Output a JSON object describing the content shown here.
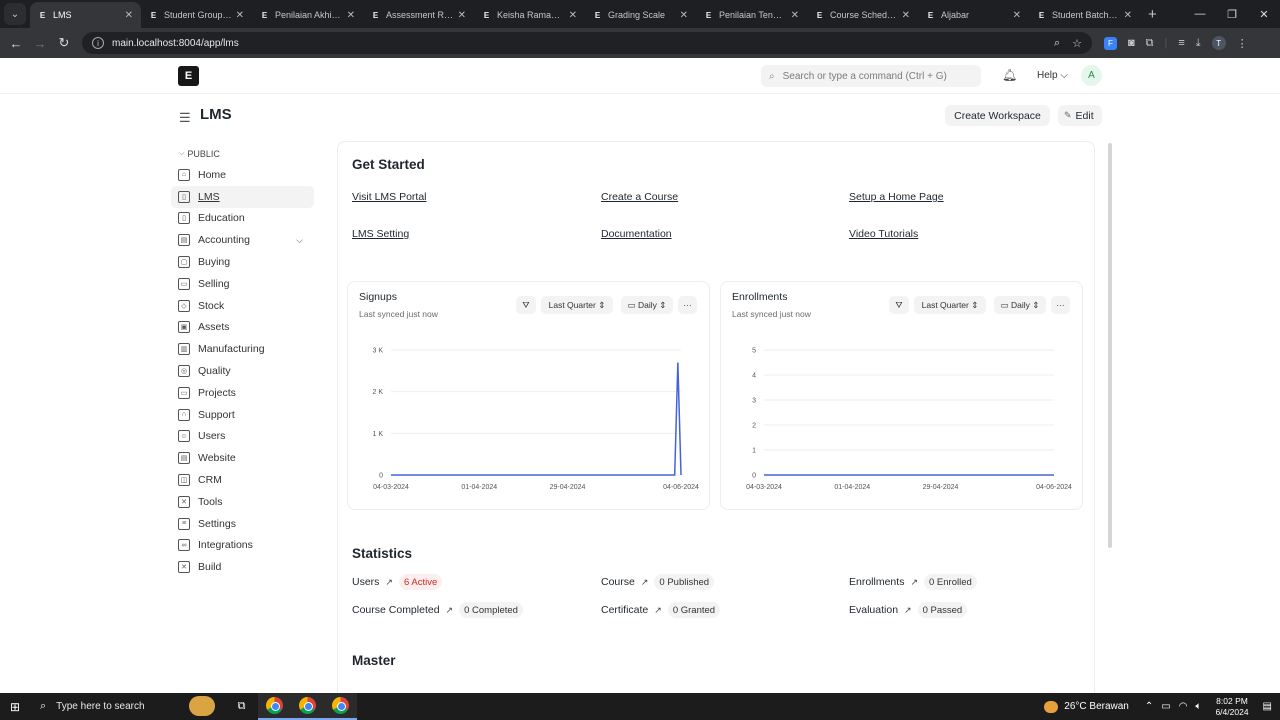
{
  "browser": {
    "tabs": [
      {
        "title": "LMS",
        "active": true
      },
      {
        "title": "Student Group Cr",
        "active": false
      },
      {
        "title": "Penilaian Akhir Se",
        "active": false
      },
      {
        "title": "Assessment Resul",
        "active": false
      },
      {
        "title": "Keisha Ramadhan",
        "active": false
      },
      {
        "title": "Grading Scale",
        "active": false
      },
      {
        "title": "Penilaian Tengah",
        "active": false
      },
      {
        "title": "Course Schedule",
        "active": false
      },
      {
        "title": "Aljabar",
        "active": false
      },
      {
        "title": "Student Batch Na",
        "active": false
      }
    ],
    "url": "main.localhost:8004/app/lms",
    "profile_initial": "T"
  },
  "navbar": {
    "search_placeholder": "Search or type a command (Ctrl + G)",
    "help_label": "Help",
    "avatar_initial": "A"
  },
  "page": {
    "title": "LMS",
    "create_workspace_label": "Create Workspace",
    "edit_label": "Edit"
  },
  "sidebar": {
    "section_label": "PUBLIC",
    "items": [
      {
        "label": "Home",
        "icon": "home-icon"
      },
      {
        "label": "LMS",
        "icon": "book-icon",
        "active": true
      },
      {
        "label": "Education",
        "icon": "book-open-icon"
      },
      {
        "label": "Accounting",
        "icon": "accounting-icon",
        "expandable": true
      },
      {
        "label": "Buying",
        "icon": "shopping-bag-icon"
      },
      {
        "label": "Selling",
        "icon": "folder-icon"
      },
      {
        "label": "Stock",
        "icon": "box-icon"
      },
      {
        "label": "Assets",
        "icon": "assets-icon"
      },
      {
        "label": "Manufacturing",
        "icon": "building-icon"
      },
      {
        "label": "Quality",
        "icon": "quality-icon"
      },
      {
        "label": "Projects",
        "icon": "projects-icon"
      },
      {
        "label": "Support",
        "icon": "headset-icon"
      },
      {
        "label": "Users",
        "icon": "users-icon"
      },
      {
        "label": "Website",
        "icon": "website-icon"
      },
      {
        "label": "CRM",
        "icon": "crm-icon"
      },
      {
        "label": "Tools",
        "icon": "tools-icon"
      },
      {
        "label": "Settings",
        "icon": "settings-icon"
      },
      {
        "label": "Integrations",
        "icon": "integrations-icon"
      },
      {
        "label": "Build",
        "icon": "build-icon"
      }
    ]
  },
  "get_started": {
    "heading": "Get Started",
    "links": [
      "Visit LMS Portal",
      "Create a Course",
      "Setup a Home Page",
      "LMS Setting",
      "Documentation",
      "Video Tutorials"
    ]
  },
  "charts": {
    "signups": {
      "title": "Signups",
      "subtitle": "Last synced just now",
      "range": "Last Quarter",
      "period": "Daily"
    },
    "enrollments": {
      "title": "Enrollments",
      "subtitle": "Last synced just now",
      "range": "Last Quarter",
      "period": "Daily"
    }
  },
  "chart_data": [
    {
      "type": "line",
      "title": "Signups",
      "x_ticks": [
        "04-03-2024",
        "01-04-2024",
        "29-04-2024",
        "04-06-2024"
      ],
      "y_ticks": [
        "0",
        "1 K",
        "2 K",
        "3 K"
      ],
      "ylim": [
        0,
        3000
      ],
      "series": [
        {
          "values_note": "",
          "points": [
            {
              "x": "04-03-2024",
              "y": 0
            },
            {
              "x": "02-06-2024",
              "y": 0
            },
            {
              "x": "03-06-2024",
              "y": 2700
            },
            {
              "x": "04-06-2024",
              "y": 0
            }
          ]
        }
      ],
      "color": "#4463d9"
    },
    {
      "type": "line",
      "title": "Enrollments",
      "x_ticks": [
        "04-03-2024",
        "01-04-2024",
        "29-04-2024",
        "04-06-2024"
      ],
      "y_ticks": [
        "0",
        "1",
        "2",
        "3",
        "4",
        "5"
      ],
      "ylim": [
        0,
        5
      ],
      "series": [
        {
          "points": [
            {
              "x": "04-03-2024",
              "y": 0
            },
            {
              "x": "04-06-2024",
              "y": 0
            }
          ]
        }
      ],
      "color": "#4463d9"
    }
  ],
  "statistics": {
    "heading": "Statistics",
    "items": [
      {
        "label": "Users",
        "value": "6 Active",
        "highlight": true
      },
      {
        "label": "Course",
        "value": "0 Published"
      },
      {
        "label": "Enrollments",
        "value": "0 Enrolled"
      },
      {
        "label": "Course Completed",
        "value": "0 Completed"
      },
      {
        "label": "Certificate",
        "value": "0 Granted"
      },
      {
        "label": "Evaluation",
        "value": "0 Passed"
      }
    ]
  },
  "master": {
    "heading": "Master"
  },
  "taskbar": {
    "search_placeholder": "Type here to search",
    "weather": "26°C  Berawan",
    "time": "8:02 PM",
    "date": "6/4/2024"
  }
}
